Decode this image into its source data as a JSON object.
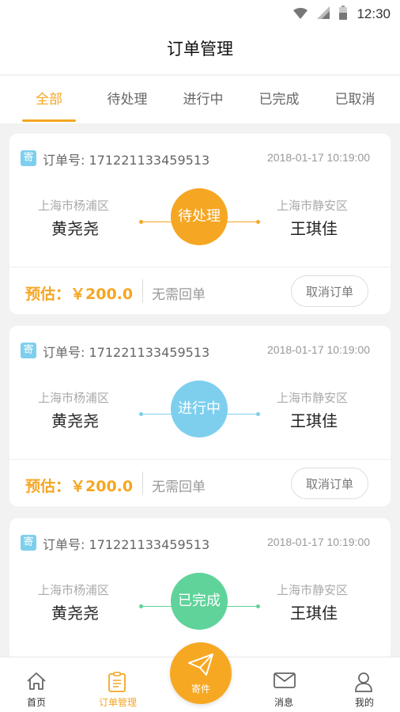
{
  "status_bar": {
    "time": "12:30"
  },
  "header": {
    "title": "订单管理"
  },
  "tabs": [
    {
      "label": "全部",
      "active": true
    },
    {
      "label": "待处理",
      "active": false
    },
    {
      "label": "进行中",
      "active": false
    },
    {
      "label": "已完成",
      "active": false
    },
    {
      "label": "已取消",
      "active": false
    }
  ],
  "orders": [
    {
      "badge": "寄",
      "order_label": "订单号: 171221133459513",
      "time": "2018-01-17 10:19:00",
      "from_city": "上海市杨浦区",
      "from_name": "黄尧尧",
      "to_city": "上海市静安区",
      "to_name": "王琪佳",
      "status": "待处理",
      "status_color": "#f5a623",
      "price": "预估：￥200.0",
      "receipt": "无需回单",
      "action": "取消订单"
    },
    {
      "badge": "寄",
      "order_label": "订单号: 171221133459513",
      "time": "2018-01-17 10:19:00",
      "from_city": "上海市杨浦区",
      "from_name": "黄尧尧",
      "to_city": "上海市静安区",
      "to_name": "王琪佳",
      "status": "进行中",
      "status_color": "#7ecfee",
      "price": "预估：￥200.0",
      "receipt": "无需回单",
      "action": "取消订单"
    },
    {
      "badge": "寄",
      "order_label": "订单号: 171221133459513",
      "time": "2018-01-17 10:19:00",
      "from_city": "上海市杨浦区",
      "from_name": "黄尧尧",
      "to_city": "上海市静安区",
      "to_name": "王琪佳",
      "status": "已完成",
      "status_color": "#5fd39a",
      "price": "",
      "receipt": "",
      "action": ""
    }
  ],
  "bottom_nav": {
    "home": "首页",
    "orders": "订单管理",
    "send": "寄件",
    "messages": "消息",
    "mine": "我的"
  },
  "colors": {
    "accent": "#f5a623"
  }
}
